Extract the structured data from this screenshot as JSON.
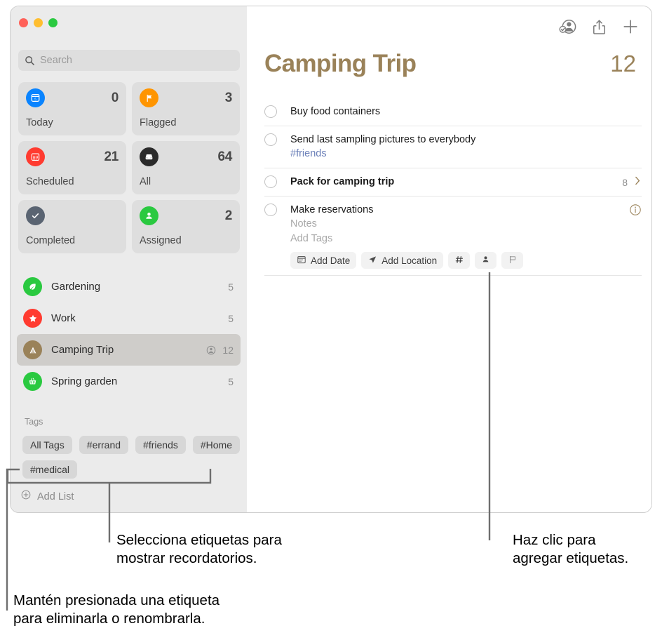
{
  "window": {
    "traffic_lights": [
      "close",
      "minimize",
      "zoom"
    ],
    "colors": {
      "accent": "#9a8259",
      "tag_link": "#6a7fb8"
    }
  },
  "sidebar": {
    "search": {
      "placeholder": "Search",
      "value": "",
      "icon": "search-icon"
    },
    "smart_lists": [
      {
        "label": "Today",
        "count": "0",
        "icon": "calendar-today-icon",
        "color": "#0a84ff"
      },
      {
        "label": "Flagged",
        "count": "3",
        "icon": "flag-icon",
        "color": "#ff9500"
      },
      {
        "label": "Scheduled",
        "count": "21",
        "icon": "calendar-icon",
        "color": "#ff3b30"
      },
      {
        "label": "All",
        "count": "64",
        "icon": "inbox-icon",
        "color": "#2b2b2b"
      },
      {
        "label": "Completed",
        "count": "",
        "icon": "checkmark-icon",
        "color": "#5a6472"
      },
      {
        "label": "Assigned",
        "count": "2",
        "icon": "person-icon",
        "color": "#2ac940"
      }
    ],
    "lists": [
      {
        "name": "Gardening",
        "count": "5",
        "icon": "leaf-icon",
        "color": "#2ac940",
        "selected": false,
        "shared": false
      },
      {
        "name": "Work",
        "count": "5",
        "icon": "star-icon",
        "color": "#ff3b30",
        "selected": false,
        "shared": false
      },
      {
        "name": "Camping Trip",
        "count": "12",
        "icon": "tent-icon",
        "color": "#9a8259",
        "selected": true,
        "shared": true
      },
      {
        "name": "Spring garden",
        "count": "5",
        "icon": "basket-icon",
        "color": "#2ac940",
        "selected": false,
        "shared": false
      }
    ],
    "tags_header": "Tags",
    "tags": [
      "All Tags",
      "#errand",
      "#friends",
      "#Home",
      "#medical"
    ],
    "add_list": {
      "label": "Add List",
      "icon": "plus-circle-icon"
    }
  },
  "main": {
    "toolbar": [
      {
        "name": "share-participants-button",
        "icon": "person-badge-check-icon"
      },
      {
        "name": "share-button",
        "icon": "share-up-icon"
      },
      {
        "name": "add-reminder-button",
        "icon": "plus-icon"
      }
    ],
    "title": "Camping Trip",
    "count": "12",
    "reminders": [
      {
        "title": "Buy food containers",
        "bold": false,
        "tag": "",
        "sub_count": "",
        "chevron": false,
        "info": false
      },
      {
        "title": "Send last sampling pictures to everybody",
        "bold": false,
        "tag": "#friends",
        "sub_count": "",
        "chevron": false,
        "info": false
      },
      {
        "title": "Pack for camping trip",
        "bold": true,
        "tag": "",
        "sub_count": "8",
        "chevron": true,
        "info": false
      },
      {
        "title": "Make reservations",
        "bold": false,
        "tag": "",
        "sub_count": "",
        "chevron": false,
        "info": true,
        "notes_placeholder": "Notes",
        "tags_placeholder": "Add Tags",
        "actions": [
          {
            "label": "Add Date",
            "icon": "calendar-icon",
            "name": "add-date-button"
          },
          {
            "label": "Add Location",
            "icon": "location-icon",
            "name": "add-location-button"
          },
          {
            "label": "#",
            "icon": "hash-icon",
            "name": "add-tag-button"
          },
          {
            "label": "",
            "icon": "person-icon",
            "name": "assign-person-button"
          },
          {
            "label": "",
            "icon": "flag-icon",
            "name": "flag-button"
          }
        ]
      }
    ]
  },
  "callouts": [
    {
      "id": "callout-select-tags",
      "lines": [
        "Selecciona etiquetas para",
        "mostrar recordatorios."
      ]
    },
    {
      "id": "callout-add-tags",
      "lines": [
        "Haz clic para",
        "agregar etiquetas."
      ]
    },
    {
      "id": "callout-hold-tag",
      "lines": [
        "Mantén presionada una etiqueta",
        "para eliminarla o renombrarla."
      ]
    }
  ]
}
